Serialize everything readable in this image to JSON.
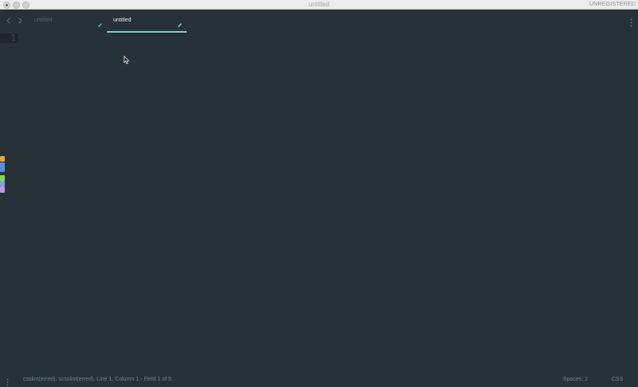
{
  "window": {
    "title": "untitled",
    "registration": "UNREGISTERED"
  },
  "navigation": {
    "back_icon": "chevron-left-icon",
    "forward_icon": "chevron-right-icon"
  },
  "tabs": [
    {
      "label": "untitled",
      "active": false,
      "icon": "pencil-icon"
    },
    {
      "label": "untitled",
      "active": true,
      "icon": "pencil-icon"
    }
  ],
  "editor": {
    "line_numbers": [
      "1"
    ]
  },
  "palette": {
    "swatches": [
      "#e8a444",
      "#5b8fd8",
      "#8ecf63",
      "#7aa8e0",
      "#c393e6"
    ]
  },
  "statusbar": {
    "info": "csslint(erred), scsslint(erred), Line 1, Column 1 - Field 1 of 5",
    "indentation": "Spaces: 2",
    "syntax": "CSS"
  },
  "colors": {
    "background": "#263238",
    "accent": "#80cbc4",
    "titlebar": "#ececec"
  }
}
